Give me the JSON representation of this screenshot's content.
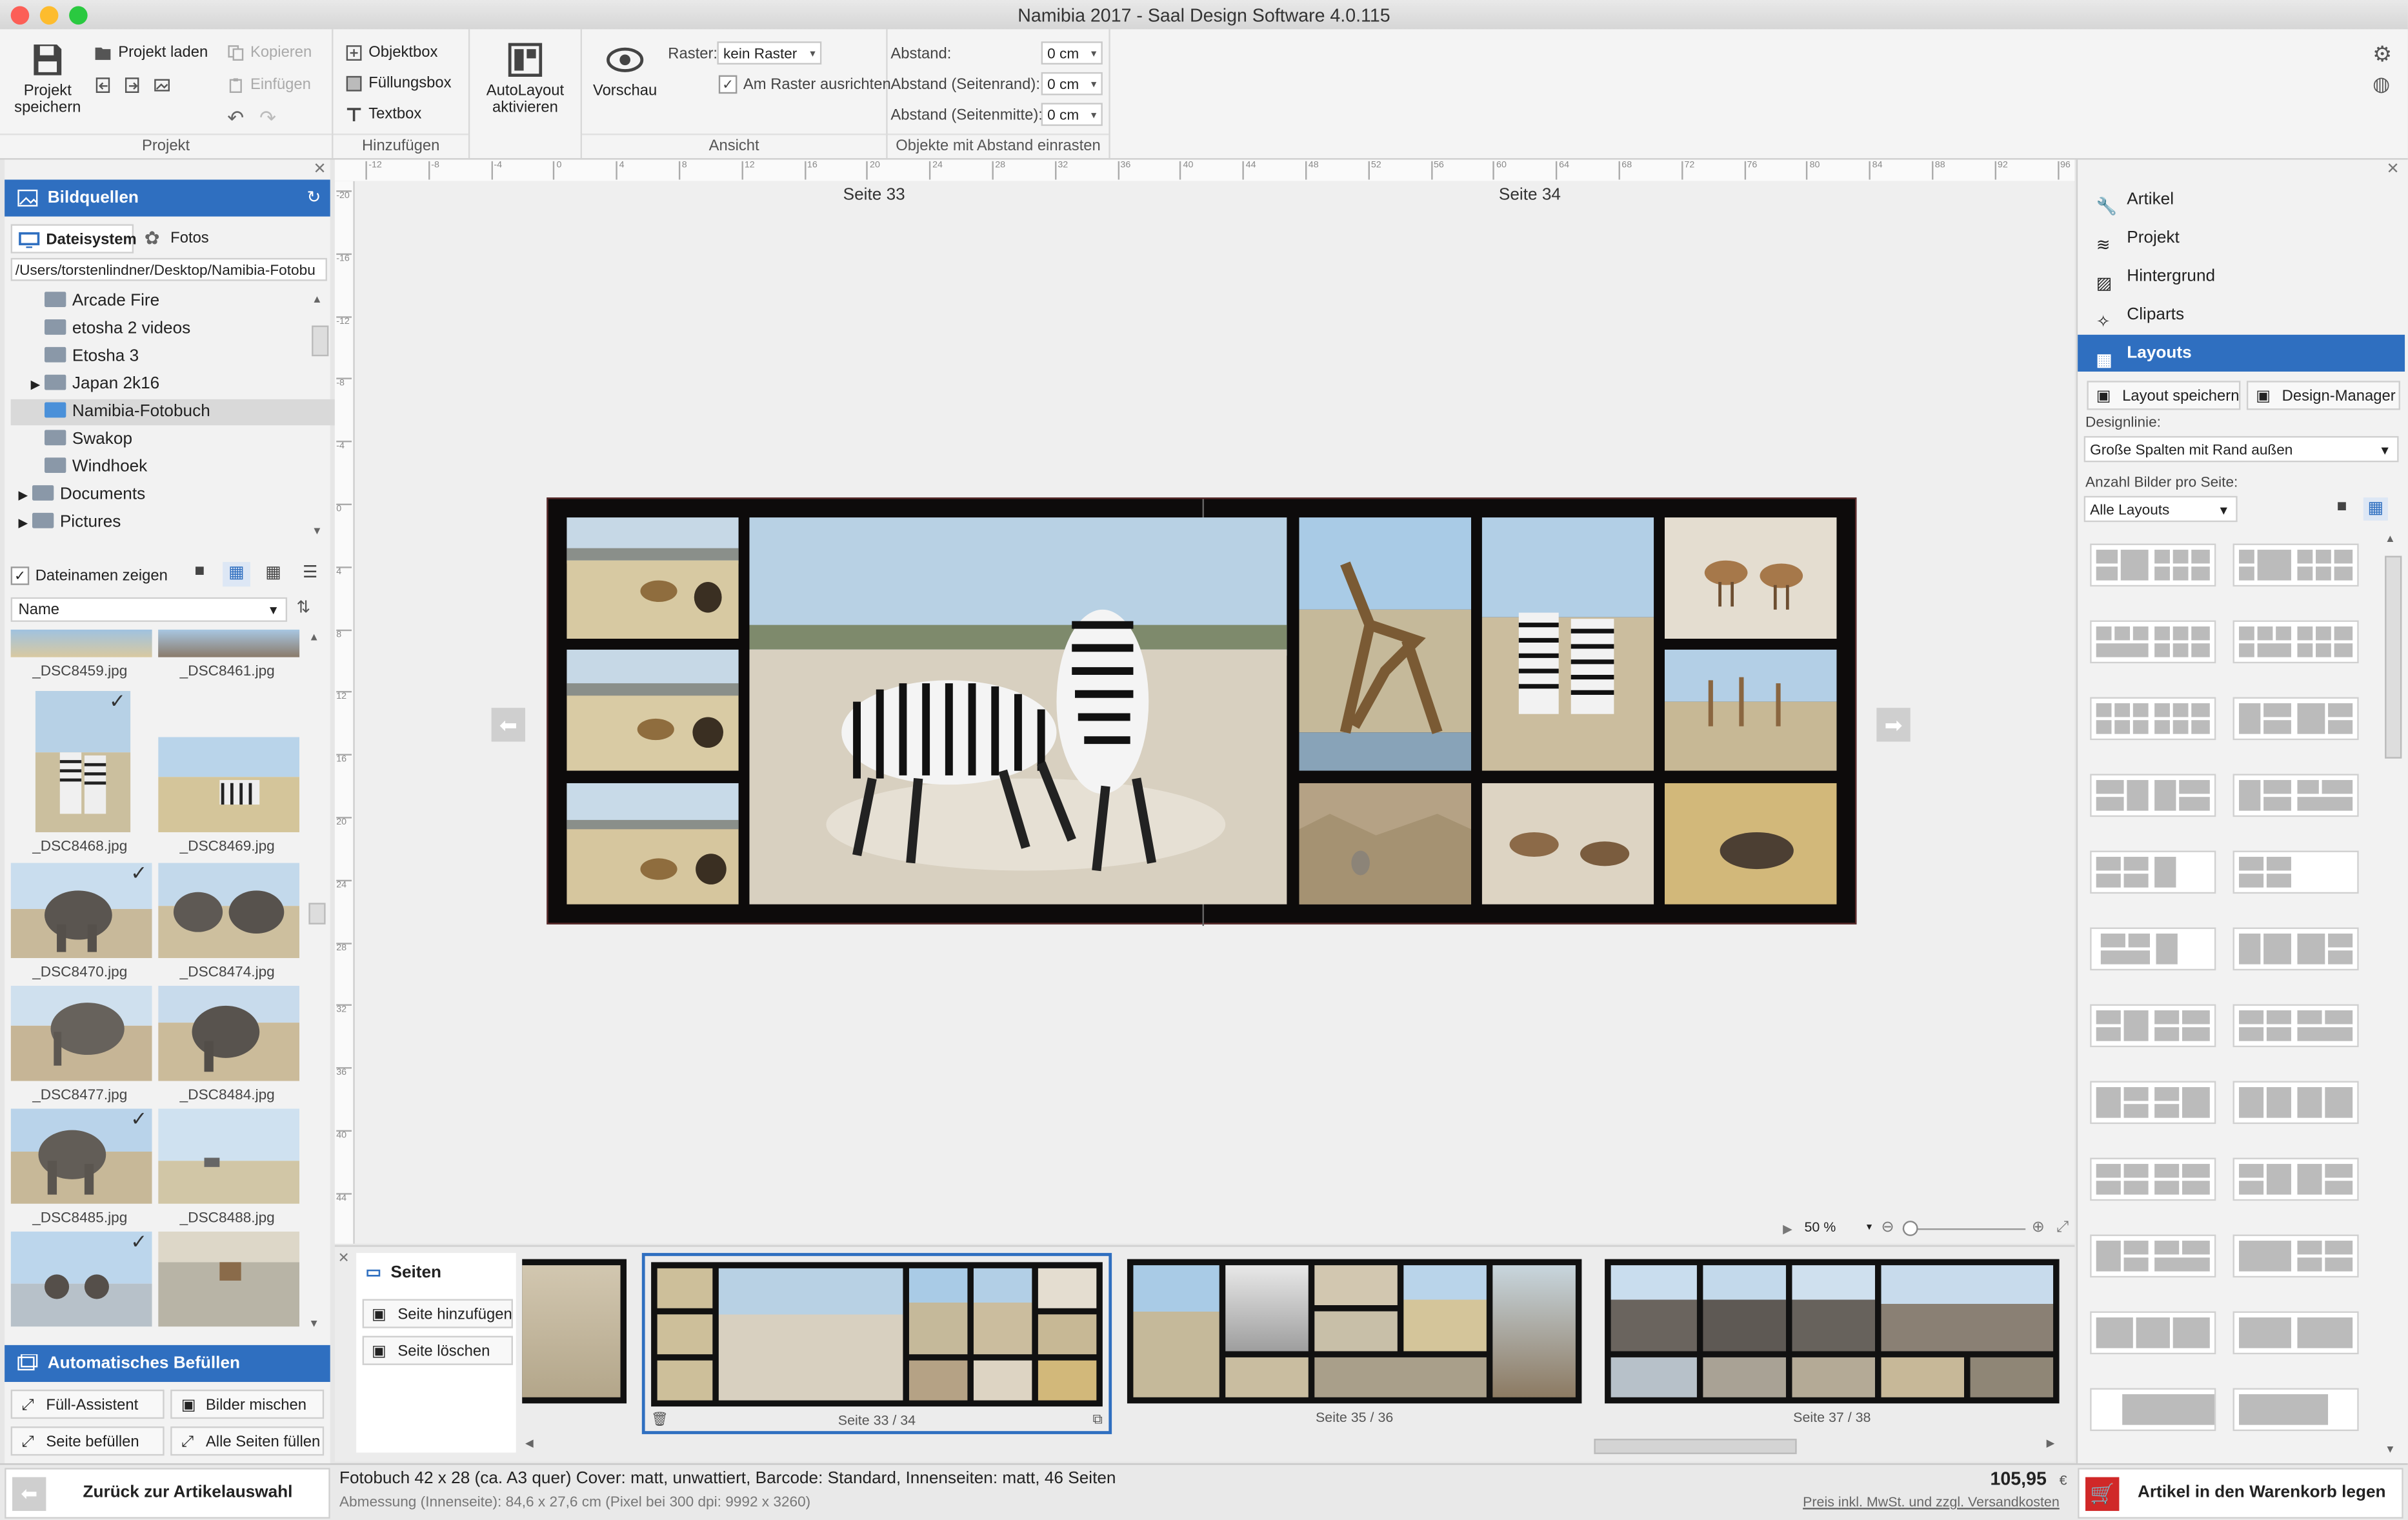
{
  "window": {
    "title": "Namibia 2017 - Saal Design Software 4.0.115"
  },
  "toolbar": {
    "projekt": {
      "save_label_1": "Projekt",
      "save_label_2": "speichern",
      "load": "Projekt laden",
      "copy": "Kopieren",
      "paste": "Einfügen",
      "group": "Projekt"
    },
    "hinzufuegen": {
      "objektbox": "Objektbox",
      "fuellungsbox": "Füllungsbox",
      "textbox": "Textbox",
      "group": "Hinzufügen"
    },
    "autolayout": {
      "label_1": "AutoLayout",
      "label_2": "aktivieren"
    },
    "ansicht": {
      "preview": "Vorschau",
      "raster_label": "Raster:",
      "raster_value": "kein Raster",
      "snap_label": "Am Raster ausrichten",
      "snap_checked": true,
      "group": "Ansicht"
    },
    "abstand": {
      "abstand_label": "Abstand:",
      "abstand_value": "0 cm",
      "rand_label": "Abstand (Seitenrand):",
      "rand_value": "0 cm",
      "mitte_label": "Abstand (Seitenmitte):",
      "mitte_value": "0 cm",
      "group": "Objekte mit Abstand einrasten"
    }
  },
  "left": {
    "header": "Bildquellen",
    "tabs": [
      "Dateisystem",
      "Fotos"
    ],
    "path": "/Users/torstenlindner/Desktop/Namibia-Fotobu",
    "tree": [
      {
        "label": "Arcade Fire"
      },
      {
        "label": "etosha 2 videos"
      },
      {
        "label": "Etosha 3"
      },
      {
        "label": "Japan 2k16"
      },
      {
        "label": "Namibia-Fotobuch"
      },
      {
        "label": "Swakop"
      },
      {
        "label": "Windhoek"
      },
      {
        "label": "Documents"
      },
      {
        "label": "Pictures"
      }
    ],
    "show_names_label": "Dateinamen zeigen",
    "sort_label": "Name",
    "files": [
      "_DSC8459.jpg",
      "_DSC8461.jpg",
      "_DSC8468.jpg",
      "_DSC8469.jpg",
      "_DSC8470.jpg",
      "_DSC8474.jpg",
      "_DSC8477.jpg",
      "_DSC8484.jpg",
      "_DSC8485.jpg",
      "_DSC8488.jpg"
    ],
    "auto_header": "Automatisches Befüllen",
    "auto_buttons": [
      "Füll-Assistent",
      "Bilder mischen",
      "Seite befüllen",
      "Alle Seiten füllen"
    ],
    "back_label": "Zurück zur Artikelauswahl"
  },
  "canvas": {
    "page_left": "Seite 33",
    "page_right": "Seite 34",
    "ruler_ticks": [
      "-12",
      "-8",
      "-4",
      "0",
      "4",
      "8",
      "12",
      "16",
      "20",
      "24",
      "28",
      "32",
      "36",
      "40",
      "44",
      "48",
      "52",
      "56",
      "60",
      "64",
      "68",
      "72",
      "76",
      "80",
      "84",
      "88",
      "92",
      "96"
    ],
    "ruler_v_ticks": [
      "-20",
      "-16",
      "-12",
      "-8",
      "-4",
      "0",
      "4",
      "8",
      "12",
      "16",
      "20",
      "24",
      "28",
      "32",
      "36",
      "40",
      "44",
      "48"
    ],
    "zoom": "50 %"
  },
  "pages": {
    "header": "Seiten",
    "add": "Seite hinzufügen",
    "delete": "Seite löschen",
    "spreads": [
      "Seite 33 / 34",
      "Seite 35 / 36",
      "Seite 37 / 38"
    ]
  },
  "right": {
    "nav": [
      "Artikel",
      "Projekt",
      "Hintergrund",
      "Cliparts",
      "Layouts"
    ],
    "save_layout": "Layout speichern",
    "design_manager": "Design-Manager",
    "designlinie_label": "Designlinie:",
    "designlinie_value": "Große Spalten mit Rand außen",
    "anzahl_label": "Anzahl Bilder pro Seite:",
    "anzahl_value": "Alle Layouts"
  },
  "status": {
    "line1": "Fotobuch 42 x 28 (ca. A3 quer) Cover: matt, unwattiert, Barcode: Standard, Innenseiten: matt, 46 Seiten",
    "line2": "Abmessung (Innenseite): 84,6 x 27,6 cm (Pixel bei 300 dpi: 9992 x 3260)",
    "price": "105,95",
    "currency": "€",
    "price_note": "Preis inkl. MwSt. und zzgl. Versandkosten",
    "cart": "Artikel in den Warenkorb legen"
  }
}
